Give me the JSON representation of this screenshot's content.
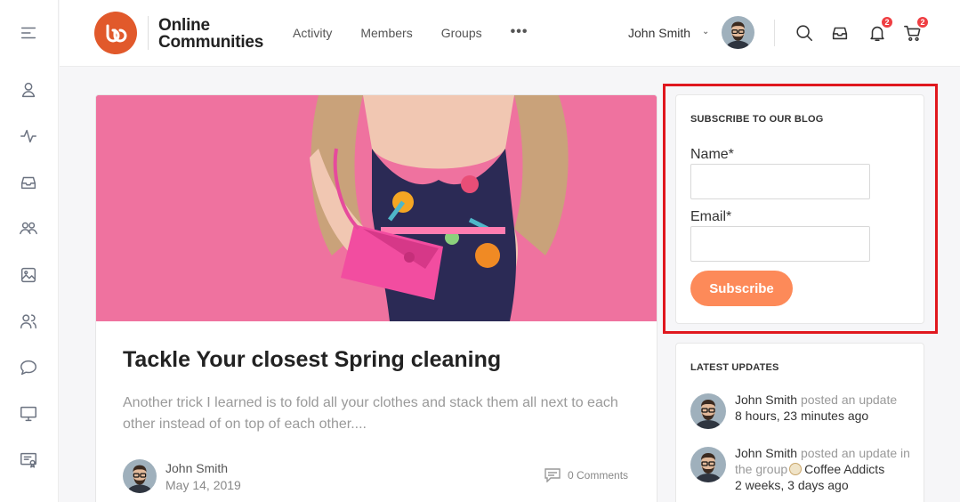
{
  "header": {
    "brand_line1": "Online",
    "brand_line2": "Communities",
    "nav": [
      "Activity",
      "Members",
      "Groups"
    ],
    "nav_more": "•••",
    "user_name": "John Smith",
    "notifications_count": "2",
    "cart_count": "2"
  },
  "sidebar": {
    "items": [
      "menu-icon",
      "profile-icon",
      "activity-icon",
      "inbox-icon",
      "groups-icon",
      "photos-icon",
      "members-icon",
      "forums-icon",
      "courses-icon",
      "certificates-icon"
    ]
  },
  "post": {
    "title": "Tackle Your closest Spring cleaning",
    "excerpt": "Another trick I learned is to fold all your clothes and stack them all next to each other instead of on top of each other....",
    "author": "John Smith",
    "date": "May 14, 2019",
    "comments": "0 Comments"
  },
  "subscribe": {
    "title": "SUBSCRIBE TO OUR BLOG",
    "name_label": "Name*",
    "email_label": "Email*",
    "button": "Subscribe"
  },
  "updates": {
    "title": "LATEST UPDATES",
    "items": [
      {
        "who": "John Smith",
        "action": "posted an update",
        "group_prefix": "",
        "group": "",
        "when": "8 hours, 23 minutes ago"
      },
      {
        "who": "John Smith",
        "action": "posted an update",
        "group_prefix": "in the group",
        "group": "Coffee Addicts",
        "when": "2 weeks, 3 days ago"
      }
    ]
  },
  "colors": {
    "brand": "#e1592b",
    "accent_button": "#fd8a59",
    "badge": "#ef3e42",
    "highlight_box": "#e0171e",
    "hero_pink": "#ef6f9f"
  }
}
